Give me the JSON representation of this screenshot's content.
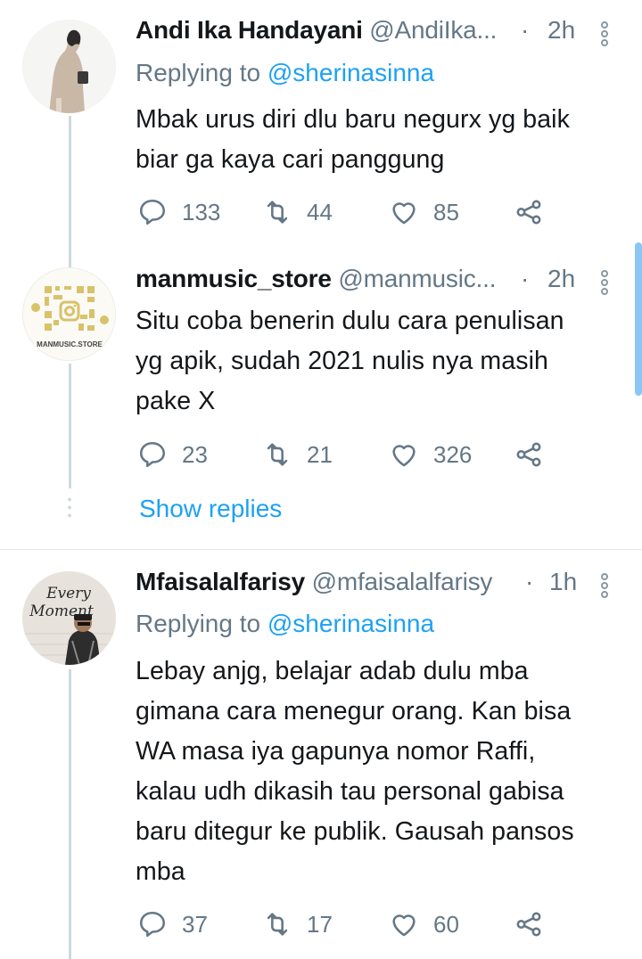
{
  "tweets": [
    {
      "name": "Andi Ika Handayani",
      "handle": "@AndiIka...",
      "time": "2h",
      "replying_prefix": "Replying to ",
      "replying_to": "@sherinasinna",
      "text_lines": [
        "Mbak urus diri dlu baru negurx yg baik",
        "biar ga kaya cari panggung"
      ],
      "replies": "133",
      "retweets": "44",
      "likes": "85"
    },
    {
      "name": "manmusic_store",
      "handle": "@manmusic...",
      "time": "2h",
      "avatar_caption": "MANMUSIC.STORE",
      "text_lines": [
        "Situ coba benerin dulu cara penulisan",
        "yg apik, sudah 2021 nulis nya masih",
        "pake X"
      ],
      "replies": "23",
      "retweets": "21",
      "likes": "326"
    },
    {
      "name": "Mfaisalalfarisy",
      "handle": "@mfaisalalfarisy",
      "time": "1h",
      "replying_prefix": "Replying to ",
      "replying_to": "@sherinasinna",
      "avatar_caption_1": "Every",
      "avatar_caption_2": "Moment",
      "text_lines": [
        "Lebay anjg, belajar adab dulu mba",
        "gimana cara menegur orang. Kan bisa",
        "WA masa iya gapunya nomor Raffi,",
        "kalau udh dikasih tau personal gabisa",
        "baru ditegur ke publik. Gausah pansos",
        "mba"
      ],
      "replies": "37",
      "retweets": "17",
      "likes": "60"
    }
  ],
  "show_replies_label": "Show replies",
  "separator_dot": "·",
  "colors": {
    "accent": "#1da1f2",
    "secondary": "#657786",
    "text": "#14171a",
    "line": "#cfd9de"
  },
  "icons": [
    "reply-icon",
    "retweet-icon",
    "like-icon",
    "share-icon",
    "more-icon"
  ]
}
